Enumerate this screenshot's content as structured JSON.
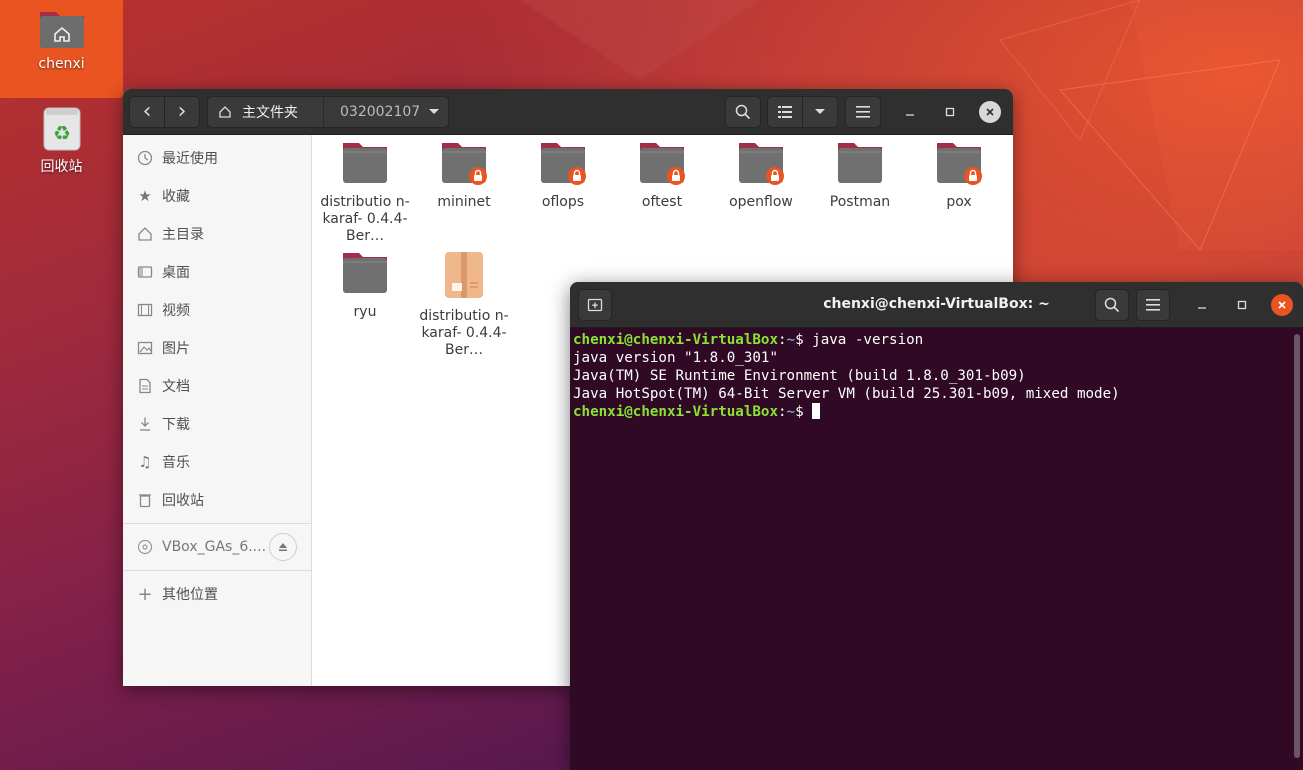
{
  "desktop": {
    "icons": [
      {
        "label": "chenxi",
        "icon": "home-folder-icon"
      },
      {
        "label": "回收站",
        "icon": "trash-icon"
      }
    ]
  },
  "file_manager": {
    "nav": {
      "back": "‹",
      "forward": "›"
    },
    "breadcrumb": {
      "home": "主文件夹",
      "current": "032002107"
    },
    "sidebar": {
      "items": [
        {
          "label": "最近使用",
          "icon": "recent-icon"
        },
        {
          "label": "收藏",
          "icon": "star-icon"
        },
        {
          "label": "主目录",
          "icon": "home-icon"
        },
        {
          "label": "桌面",
          "icon": "desktop-icon"
        },
        {
          "label": "视频",
          "icon": "video-icon"
        },
        {
          "label": "图片",
          "icon": "picture-icon"
        },
        {
          "label": "文档",
          "icon": "document-icon"
        },
        {
          "label": "下载",
          "icon": "download-icon"
        },
        {
          "label": "音乐",
          "icon": "music-icon"
        },
        {
          "label": "回收站",
          "icon": "trash-icon"
        }
      ],
      "device": {
        "label": "VBox_GAs_6....",
        "icon": "disc-icon"
      },
      "other": {
        "label": "其他位置",
        "icon": "plus-icon"
      }
    },
    "files": [
      {
        "name": "distributio n-karaf- 0.4.4-Ber…",
        "type": "folder",
        "locked": false
      },
      {
        "name": "mininet",
        "type": "folder",
        "locked": true
      },
      {
        "name": "oflops",
        "type": "folder",
        "locked": true
      },
      {
        "name": "oftest",
        "type": "folder",
        "locked": true
      },
      {
        "name": "openflow",
        "type": "folder",
        "locked": true
      },
      {
        "name": "Postman",
        "type": "folder",
        "locked": false
      },
      {
        "name": "pox",
        "type": "folder",
        "locked": true
      },
      {
        "name": "ryu",
        "type": "folder",
        "locked": false
      },
      {
        "name": "distributio n-karaf- 0.4.4-Ber…",
        "type": "archive",
        "locked": false
      }
    ]
  },
  "terminal": {
    "title": "chenxi@chenxi-VirtualBox: ~",
    "prompt_user": "chenxi@chenxi-VirtualBox",
    "prompt_path": "~",
    "lines": [
      {
        "kind": "prompt",
        "command": " java -version"
      },
      {
        "kind": "output",
        "text": "java version \"1.8.0_301\""
      },
      {
        "kind": "output",
        "text": "Java(TM) SE Runtime Environment (build 1.8.0_301-b09)"
      },
      {
        "kind": "output",
        "text": "Java HotSpot(TM) 64-Bit Server VM (build 25.301-b09, mixed mode)"
      },
      {
        "kind": "prompt",
        "command": " "
      }
    ]
  },
  "colors": {
    "accent": "#e95420",
    "terminal_bg": "#300a24",
    "prompt_user": "#8ae234",
    "prompt_path": "#729fcf"
  }
}
